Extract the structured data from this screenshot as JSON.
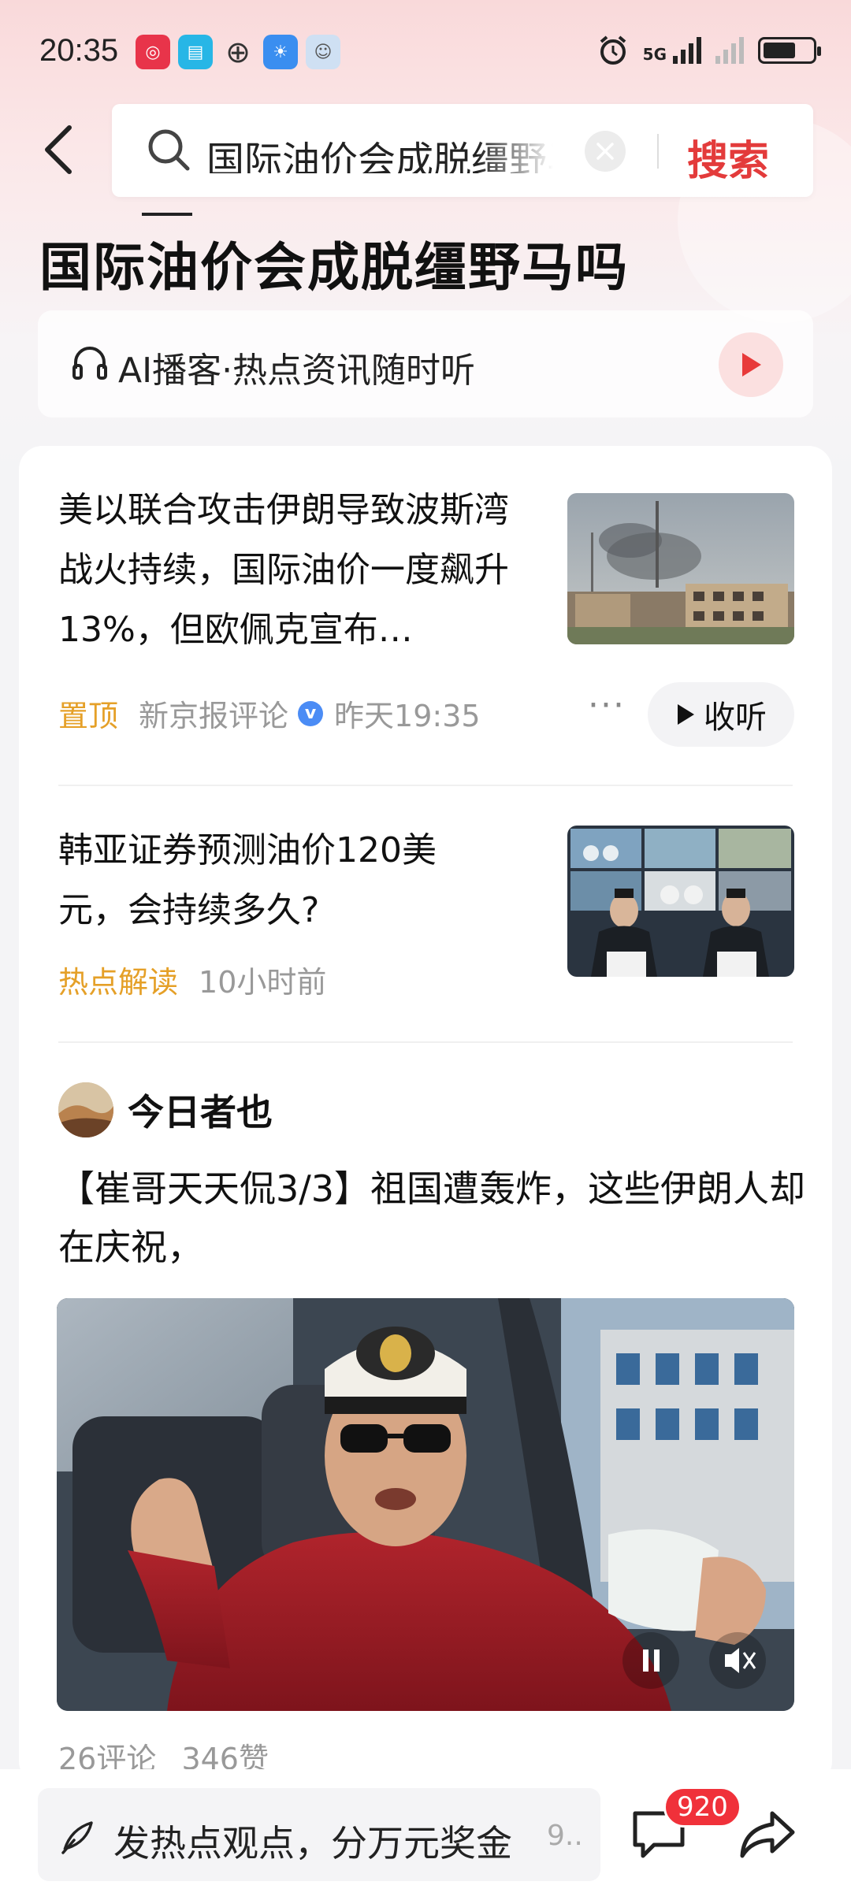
{
  "status_bar": {
    "time": "20:35",
    "network": "5G",
    "icons": [
      "app-icon-red",
      "book-icon",
      "globe-icon",
      "weather-icon",
      "chat-app-icon",
      "alarm-icon",
      "signal-icon",
      "battery-icon"
    ]
  },
  "header": {
    "search_query": "国际油价会成脱缰野马吗",
    "search_button": "搜索"
  },
  "page_title": "国际油价会成脱缰野马吗",
  "podcast": {
    "label": "AI播客·热点资讯随时听"
  },
  "news": [
    {
      "title": "美以联合攻击伊朗导致波斯湾战火持续，国际油价一度飙升13%，但欧佩克宣布…",
      "tag": "置顶",
      "source": "新京报评论",
      "verified_mark": "v",
      "time": "昨天19:35",
      "more": "···",
      "action": "收听"
    },
    {
      "title": "韩亚证券预测油价120美元，会持续多久?",
      "tag": "热点解读",
      "time": "10小时前"
    }
  ],
  "post": {
    "author": "今日者也",
    "text": "【崔哥天天侃3/3】祖国遭轰炸，这些伊朗人却在庆祝，",
    "comments": "26评论",
    "likes": "346赞"
  },
  "bottom_bar": {
    "input_placeholder": "发热点观点，分万元奖金",
    "input_trail": "9..",
    "badge_count": "920"
  },
  "colors": {
    "accent_red": "#e33b3b",
    "tag_orange": "#e5a028",
    "badge_red": "#f0313a",
    "verified_blue": "#4b8cf5"
  }
}
